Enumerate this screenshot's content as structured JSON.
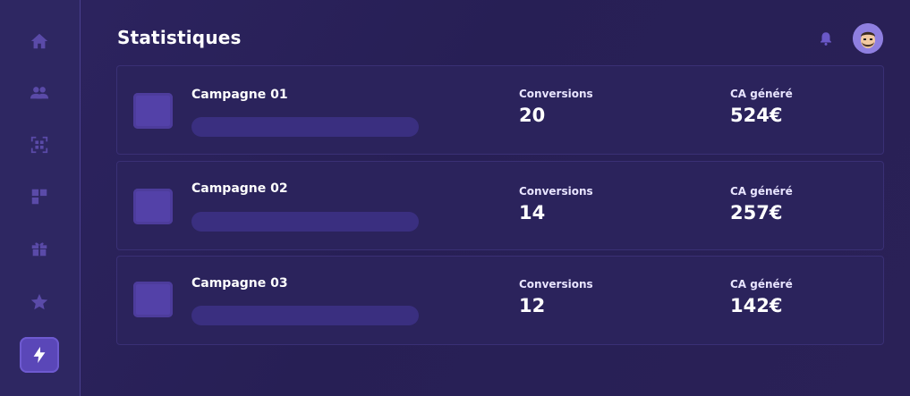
{
  "page": {
    "title": "Statistiques"
  },
  "sidebar": {
    "items": [
      {
        "icon": "home-icon",
        "active": false
      },
      {
        "icon": "users-icon",
        "active": false
      },
      {
        "icon": "scan-icon",
        "active": false
      },
      {
        "icon": "dashboard-icon",
        "active": false
      },
      {
        "icon": "gift-icon",
        "active": false
      },
      {
        "icon": "star-icon",
        "active": false
      },
      {
        "icon": "lightning-icon",
        "active": true
      }
    ]
  },
  "header": {
    "notifications_icon": "bell-icon",
    "avatar": "user-avatar"
  },
  "campaigns": [
    {
      "name": "Campagne 01",
      "conversions_label": "Conversions",
      "conversions": "20",
      "revenue_label": "CA généré",
      "revenue": "524€"
    },
    {
      "name": "Campagne 02",
      "conversions_label": "Conversions",
      "conversions": "14",
      "revenue_label": "CA généré",
      "revenue": "257€"
    },
    {
      "name": "Campagne 03",
      "conversions_label": "Conversions",
      "conversions": "12",
      "revenue_label": "CA généré",
      "revenue": "142€"
    }
  ],
  "colors": {
    "background": "#2a2157",
    "accent": "#5a47b8",
    "icon": "#5a4aa8"
  }
}
